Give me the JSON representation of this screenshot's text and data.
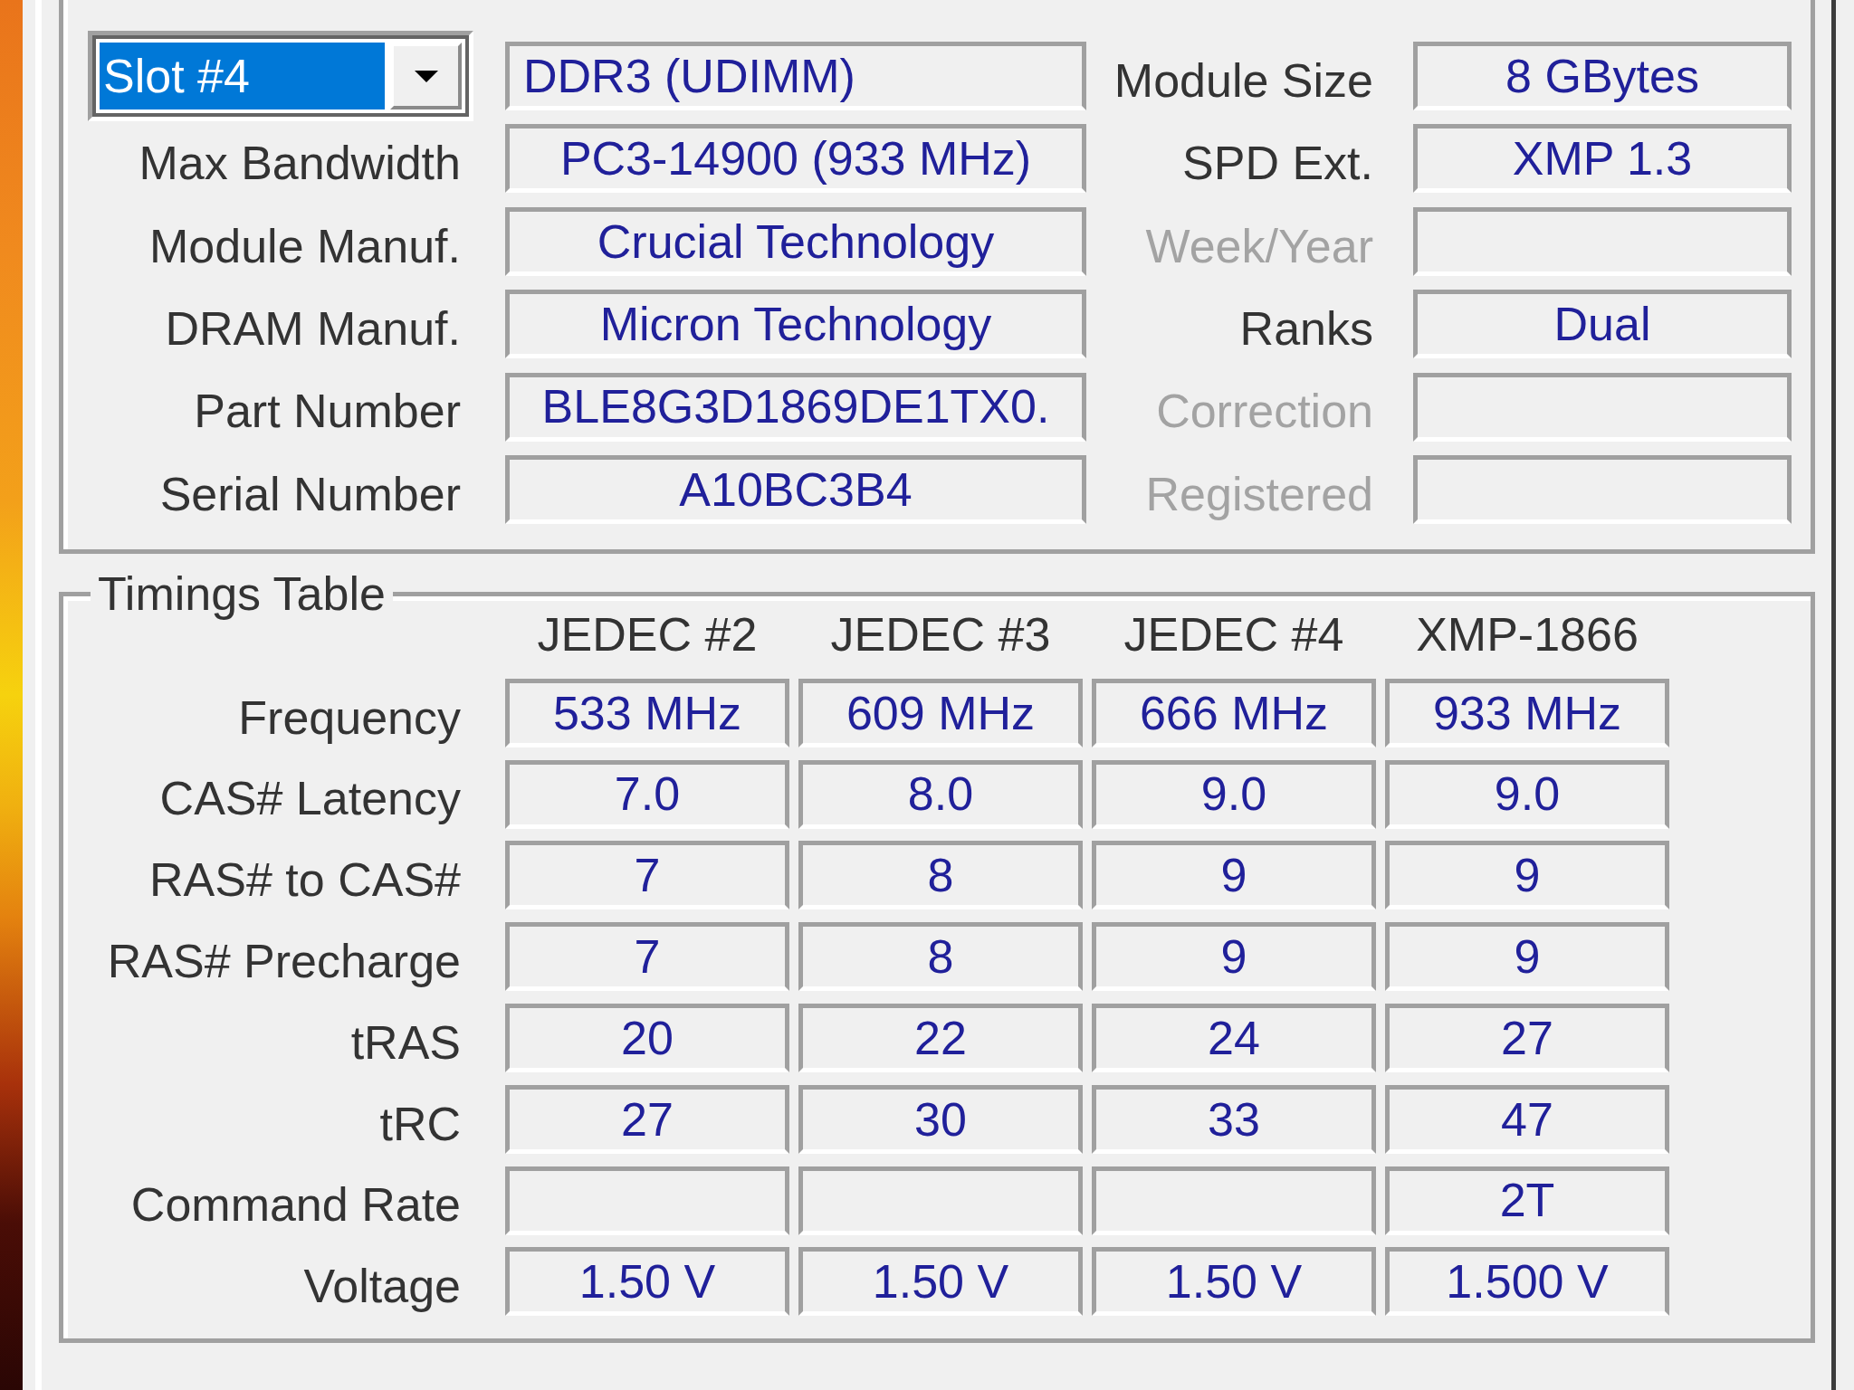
{
  "slot_selection": {
    "slot_dropdown": {
      "value": "Slot #4",
      "focused": true
    },
    "memory_type": "DDR3 (UDIMM)",
    "left_fields": [
      {
        "label": "Max Bandwidth",
        "value": "PC3-14900 (933 MHz)"
      },
      {
        "label": "Module Manuf.",
        "value": "Crucial Technology"
      },
      {
        "label": "DRAM Manuf.",
        "value": "Micron Technology"
      },
      {
        "label": "Part Number",
        "value": "BLE8G3D1869DE1TX0."
      },
      {
        "label": "Serial Number",
        "value": "A10BC3B4"
      }
    ],
    "right_fields": [
      {
        "label": "Module Size",
        "value": "8 GBytes",
        "disabled": false
      },
      {
        "label": "SPD Ext.",
        "value": "XMP 1.3",
        "disabled": false
      },
      {
        "label": "Week/Year",
        "disabled": true
      },
      {
        "label": "Ranks",
        "value": "Dual",
        "disabled": false
      },
      {
        "label": "Correction",
        "disabled": true
      },
      {
        "label": "Registered",
        "disabled": true
      }
    ]
  },
  "timings_table": {
    "title": "Timings Table",
    "columns": [
      "JEDEC #2",
      "JEDEC #3",
      "JEDEC #4",
      "XMP-1866"
    ],
    "rows": [
      {
        "label": "Frequency",
        "cells": [
          {
            "value": "533 MHz"
          },
          {
            "value": "609 MHz"
          },
          {
            "value": "666 MHz"
          },
          {
            "value": "933 MHz"
          }
        ]
      },
      {
        "label": "CAS# Latency",
        "cells": [
          {
            "value": "7.0"
          },
          {
            "value": "8.0"
          },
          {
            "value": "9.0"
          },
          {
            "value": "9.0"
          }
        ]
      },
      {
        "label": "RAS# to CAS#",
        "cells": [
          {
            "value": "7"
          },
          {
            "value": "8"
          },
          {
            "value": "9"
          },
          {
            "value": "9"
          }
        ]
      },
      {
        "label": "RAS# Precharge",
        "cells": [
          {
            "value": "7"
          },
          {
            "value": "8"
          },
          {
            "value": "9"
          },
          {
            "value": "9"
          }
        ]
      },
      {
        "label": "tRAS",
        "cells": [
          {
            "value": "20"
          },
          {
            "value": "22"
          },
          {
            "value": "24"
          },
          {
            "value": "27"
          }
        ]
      },
      {
        "label": "tRC",
        "cells": [
          {
            "value": "27"
          },
          {
            "value": "30"
          },
          {
            "value": "33"
          },
          {
            "value": "47"
          }
        ]
      },
      {
        "label": "Command Rate",
        "cells": [
          {},
          {},
          {},
          {
            "value": "2T"
          }
        ]
      },
      {
        "label": "Voltage",
        "cells": [
          {
            "value": "1.50 V"
          },
          {
            "value": "1.50 V"
          },
          {
            "value": "1.50 V"
          },
          {
            "value": "1.500 V"
          }
        ]
      }
    ]
  }
}
